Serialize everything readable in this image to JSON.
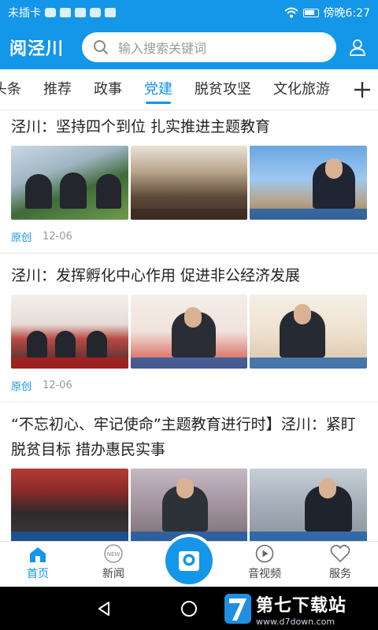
{
  "status_bar": {
    "carrier": "未插卡",
    "time": "傍晚6:27"
  },
  "header": {
    "app_title": "阅泾川",
    "search_placeholder": "输入搜索关键词"
  },
  "tabs": [
    {
      "label": "头条"
    },
    {
      "label": "推荐"
    },
    {
      "label": "政事"
    },
    {
      "label": "党建",
      "active": true
    },
    {
      "label": "脱贫攻坚"
    },
    {
      "label": "文化旅游"
    }
  ],
  "articles": [
    {
      "title": "泾川：坚持四个到位 扎实推进主题教育",
      "tag": "原创",
      "date": "12-06"
    },
    {
      "title": "泾川：发挥孵化中心作用 促进非公经济发展",
      "tag": "原创",
      "date": "12-06"
    },
    {
      "title": "“不忘初心、牢记使命”主题教育进行时】泾川：紧盯脱贫目标 措办惠民实事",
      "tag": "",
      "date": ""
    }
  ],
  "bottom_nav": {
    "home": "首页",
    "news": "新闻",
    "news_badge": "NEW",
    "video": "音视频",
    "service": "服务"
  },
  "watermark": {
    "name": "第七下载站",
    "url": "www.d7down.com"
  },
  "colors": {
    "brand": "#1496e9"
  }
}
